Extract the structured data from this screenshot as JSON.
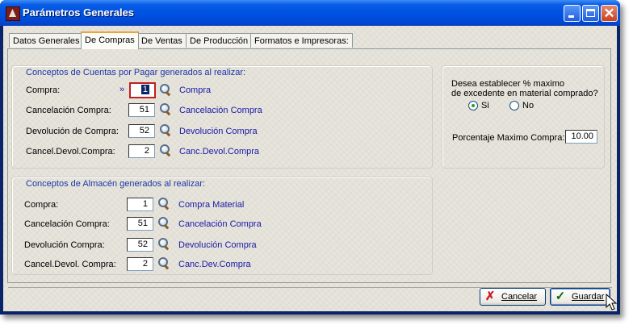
{
  "window": {
    "title": "Parámetros Generales",
    "controls": [
      "minimize-icon",
      "maximize-icon",
      "close-icon"
    ],
    "close_glyph": "✕"
  },
  "tabs": [
    {
      "label": "Datos Generales",
      "active": false
    },
    {
      "label": "De Compras",
      "active": true
    },
    {
      "label": "De Ventas",
      "active": false
    },
    {
      "label": "De Producción",
      "active": false
    },
    {
      "label": "Formatos e Impresoras:",
      "active": false
    }
  ],
  "cuentas_group": {
    "title": "Conceptos de Cuentas por Pagar generados al realizar:",
    "focus_marker": "»",
    "rows": [
      {
        "label": "Compra:",
        "value": "1",
        "link": "Compra"
      },
      {
        "label": "Cancelación Compra:",
        "value": "51",
        "link": "Cancelación Compra"
      },
      {
        "label": "Devolución de Compra:",
        "value": "52",
        "link": "Devolución Compra"
      },
      {
        "label": "Cancel.Devol.Compra:",
        "value": "2",
        "link": "Canc.Devol.Compra"
      }
    ]
  },
  "almacen_group": {
    "title": "Conceptos de Almacén generados al realizar:",
    "rows": [
      {
        "label": "Compra:",
        "value": "1",
        "link": "Compra Material"
      },
      {
        "label": "Cancelación Compra:",
        "value": "51",
        "link": "Cancelación Compra"
      },
      {
        "label": "Devolución Compra:",
        "value": "52",
        "link": "Devolución Compra"
      },
      {
        "label": "Cancel.Devol. Compra:",
        "value": "2",
        "link": "Canc.Dev.Compra"
      }
    ]
  },
  "excedente_group": {
    "question_line1": "Desea establecer  % maximo",
    "question_line2": "de excedente en material comprado?",
    "option_yes": "Si",
    "option_no": "No",
    "selected": "Si",
    "max_label": "Porcentaje Maximo Compra:",
    "max_value": "10.00"
  },
  "buttons": {
    "cancel_label": "Cancelar",
    "save_label": "Guardar"
  },
  "colors": {
    "titlebar": "#0054e3",
    "group_title": "#1d37a8",
    "link": "#1a1aa8",
    "focus_border": "#c02020"
  }
}
